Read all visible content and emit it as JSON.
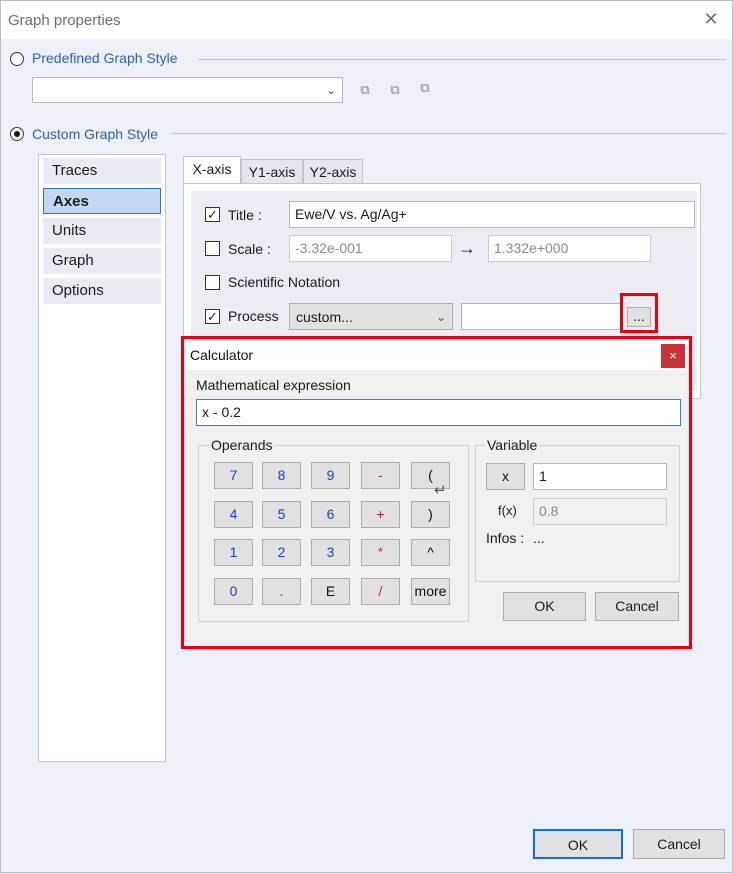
{
  "window": {
    "title": "Graph properties",
    "close_glyph": "✕"
  },
  "predefined": {
    "label": "Predefined Graph Style",
    "selected": ""
  },
  "custom": {
    "label": "Custom Graph Style"
  },
  "nav": {
    "items": [
      "Traces",
      "Axes",
      "Units",
      "Graph",
      "Options"
    ],
    "active": "Axes"
  },
  "tabs": [
    "X-axis",
    "Y1-axis",
    "Y2-axis"
  ],
  "xaxis": {
    "title_label": "Title :",
    "title_value": "Ewe/V vs. Ag/Ag+",
    "title_checked": true,
    "scale_label": "Scale :",
    "scale_checked": false,
    "scale_min": "-3.32e-001",
    "arrow": "→",
    "scale_max": "1.332e+000",
    "scinot_label": "Scientific Notation",
    "scinot_checked": false,
    "process_label": "Process",
    "process_checked": true,
    "process_option": "custom...",
    "process_expr": "",
    "ellipsis_label": "..."
  },
  "calculator": {
    "title": "Calculator",
    "close_glyph": "×",
    "expr_label": "Mathematical expression",
    "expr_value": "x - 0.2",
    "operands_label": "Operands",
    "keys": [
      [
        "7",
        "8",
        "9",
        "-",
        "("
      ],
      [
        "4",
        "5",
        "6",
        "+",
        ")"
      ],
      [
        "1",
        "2",
        "3",
        "*",
        "^"
      ],
      [
        "0",
        ".",
        "E",
        "/",
        "more"
      ]
    ],
    "enter_glyph": "↵",
    "variable_label": "Variable",
    "var_button": "x",
    "var_value": "1",
    "fx_label": "f(x)",
    "fx_value": "0.8",
    "infos_label": "Infos :",
    "infos_value": "...",
    "ok": "OK",
    "cancel": "Cancel"
  },
  "footer": {
    "ok": "OK",
    "cancel": "Cancel"
  },
  "colors": {
    "accent": "#2c5fb8",
    "highlight": "#e8000c",
    "close_red": "#c8343a"
  }
}
